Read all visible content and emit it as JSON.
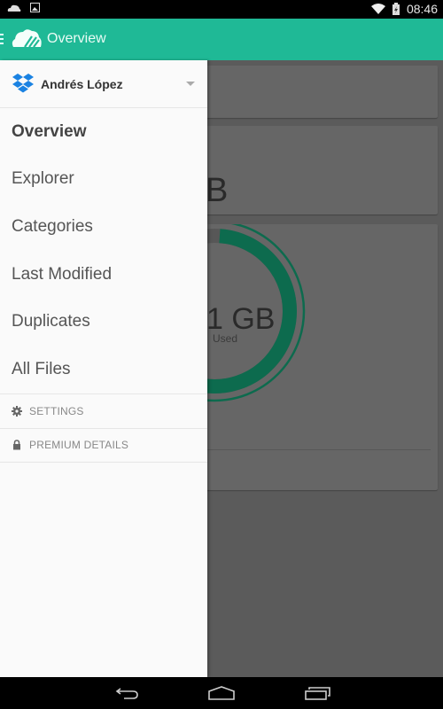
{
  "status_bar": {
    "time": "08:46",
    "icons": [
      "cloud-notification-icon",
      "image-notification-icon",
      "wifi-icon",
      "battery-charging-icon"
    ]
  },
  "app_bar": {
    "title": "Overview",
    "icons": [
      "menu-icon",
      "app-logo-icon"
    ],
    "accent_color": "#1fb996"
  },
  "drawer": {
    "account": {
      "name": "Andrés López",
      "service_icon": "dropbox-icon",
      "service_color": "#1a82e2"
    },
    "nav_items": [
      {
        "label": "Overview",
        "active": true
      },
      {
        "label": "Explorer",
        "active": false
      },
      {
        "label": "Categories",
        "active": false
      },
      {
        "label": "Last Modified",
        "active": false
      },
      {
        "label": "Duplicates",
        "active": false
      },
      {
        "label": "All Files",
        "active": false
      }
    ],
    "sections": [
      {
        "label": "SETTINGS",
        "icon": "gear-icon"
      },
      {
        "label": "PREMIUM DETAILS",
        "icon": "lock-icon"
      }
    ]
  },
  "background": {
    "space_card_value_fragment": "B",
    "usage_card": {
      "value_fragment": "1 GB",
      "caption_fragment": "Used",
      "used_fraction": 0.97,
      "ring_color": "#0d6b4e"
    }
  },
  "nav_bar": {
    "buttons": [
      "back-button",
      "home-button",
      "recents-button"
    ]
  }
}
